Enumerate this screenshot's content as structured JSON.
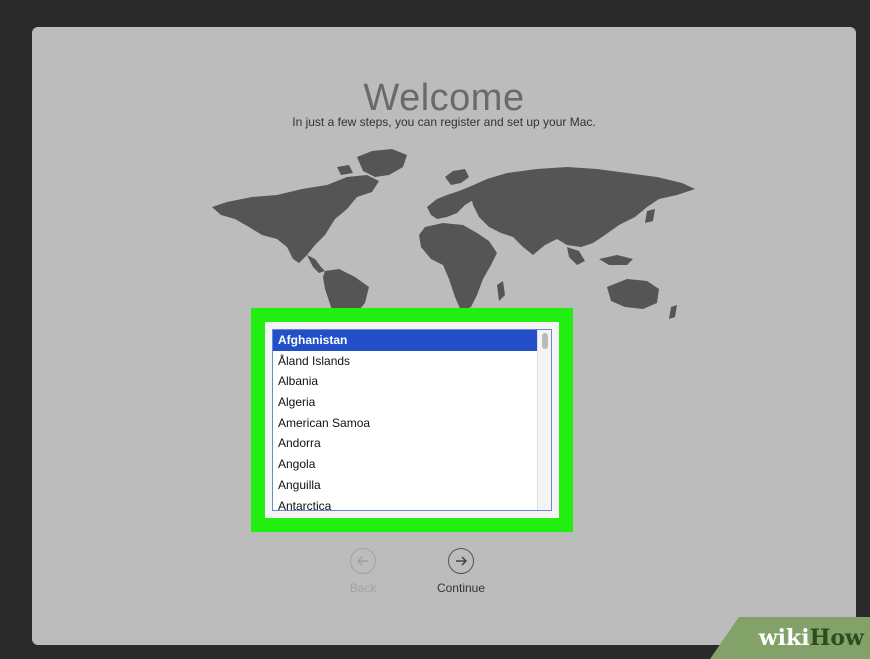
{
  "welcome": {
    "title": "Welcome",
    "subtitle": "In just a few steps, you can register and set up your Mac."
  },
  "country_list": {
    "selected": "Afghanistan",
    "items": [
      "Afghanistan",
      "Åland Islands",
      "Albania",
      "Algeria",
      "American Samoa",
      "Andorra",
      "Angola",
      "Anguilla",
      "Antarctica"
    ]
  },
  "nav": {
    "back_label": "Back",
    "continue_label": "Continue"
  },
  "watermark": {
    "wiki": "wiki",
    "how": "How"
  },
  "colors": {
    "highlight": "#22ee11",
    "selection": "#2350c8",
    "background": "#bcbcbc"
  }
}
